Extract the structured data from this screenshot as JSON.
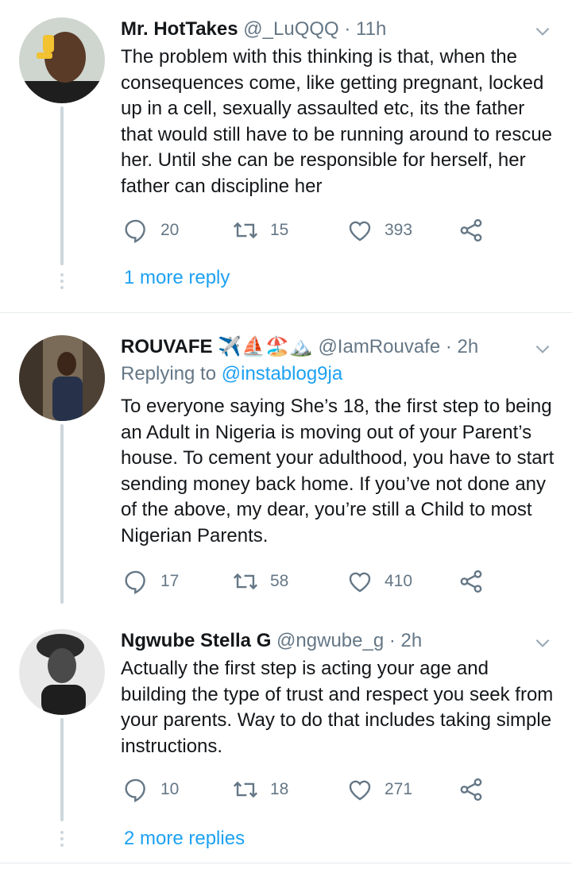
{
  "tweets": [
    {
      "name": "Mr. HotTakes",
      "handle": "@_LuQQQ",
      "sep": "·",
      "time": "11h",
      "text": "The problem with this thinking is that, when the consequences come, like getting pregnant, locked up in a cell, sexually assaulted etc, its the father that would still have to be running around to rescue her. Until she can be responsible for herself, her father can discipline her",
      "replies": "20",
      "retweets": "15",
      "likes": "393"
    },
    {
      "name": "ROUVAFE ✈️⛵🏖️🏔️",
      "handle": "@IamRouvafe",
      "sep": "·",
      "time": "2h",
      "replying_prefix": "Replying to ",
      "replying_to": "@instablog9ja",
      "text": "To everyone saying She’s 18, the first step to being an Adult in Nigeria is moving out of your Parent’s house. To cement your adulthood, you have to start sending money back home. If you’ve not done any of the above, my dear, you’re still a Child to most Nigerian Parents.",
      "replies": "17",
      "retweets": "58",
      "likes": "410"
    },
    {
      "name": "Ngwube Stella G",
      "handle": "@ngwube_g",
      "sep": "·",
      "time": "2h",
      "text": "Actually the first step is acting your age and building the type of trust and respect you seek from your parents. Way to do that includes taking simple instructions.",
      "replies": "10",
      "retweets": "18",
      "likes": "271"
    }
  ],
  "thread_links": {
    "first": "1 more reply",
    "second": "2 more replies"
  },
  "colors": {
    "link": "#1da1f2",
    "muted": "#657786",
    "line": "#ccd6dd"
  },
  "icons": [
    "reply-icon",
    "retweet-icon",
    "like-icon",
    "share-icon",
    "chevron-down-icon"
  ]
}
